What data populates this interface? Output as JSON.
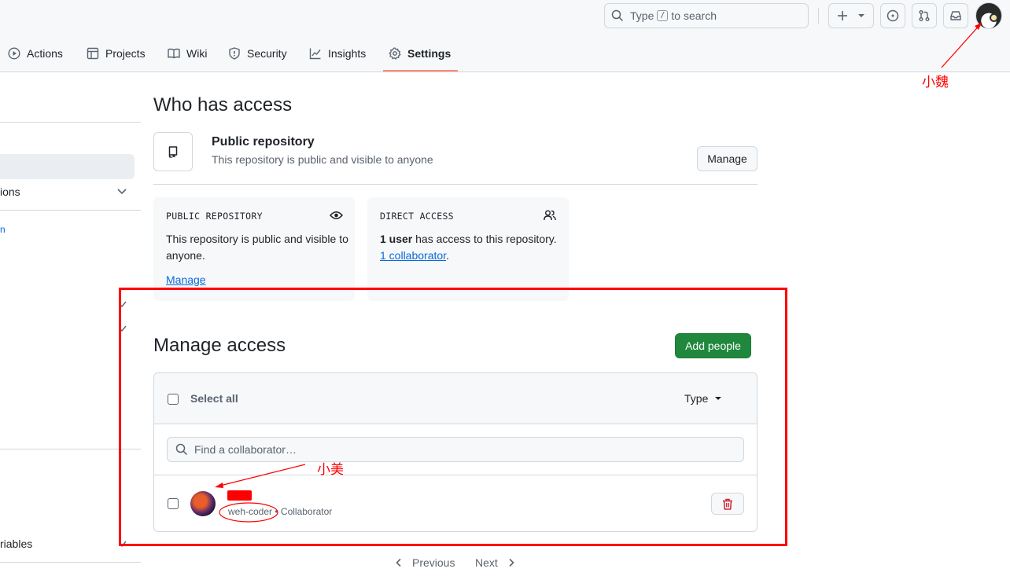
{
  "header": {
    "search_prefix": "Type",
    "search_key": "/",
    "search_suffix": "to search",
    "avatar_label": "user avatar"
  },
  "tabs": [
    {
      "label": "Actions",
      "icon": "play-icon"
    },
    {
      "label": "Projects",
      "icon": "table-icon"
    },
    {
      "label": "Wiki",
      "icon": "book-icon"
    },
    {
      "label": "Security",
      "icon": "shield-icon"
    },
    {
      "label": "Insights",
      "icon": "graph-icon"
    },
    {
      "label": "Settings",
      "icon": "gear-icon",
      "active": true
    }
  ],
  "sidebar": {
    "partial_items": [
      "ions",
      "n",
      "riables"
    ]
  },
  "who_has_access": {
    "title": "Who has access",
    "repo_type_title": "Public repository",
    "repo_type_desc": "This repository is public and visible to anyone",
    "manage_label": "Manage",
    "cards": [
      {
        "title": "PUBLIC REPOSITORY",
        "icon": "eye-icon",
        "body": "This repository is public and visible to anyone.",
        "link": "Manage"
      },
      {
        "title": "DIRECT ACCESS",
        "icon": "people-icon",
        "bold": "1 user",
        "body_mid": " has access to this repository. ",
        "link": "1 collaborator",
        "tail": "."
      }
    ]
  },
  "manage_access": {
    "title": "Manage access",
    "add_people": "Add people",
    "select_all": "Select all",
    "type_filter": "Type",
    "find_placeholder": "Find a collaborator…",
    "collaborators": [
      {
        "username": "weh-coder",
        "separator": " • ",
        "role": "Collaborator"
      }
    ]
  },
  "pagination": {
    "previous": "Previous",
    "next": "Next"
  },
  "annotations": {
    "top_right": "小魏",
    "collaborator": "小美",
    "color": "#ff0000"
  }
}
